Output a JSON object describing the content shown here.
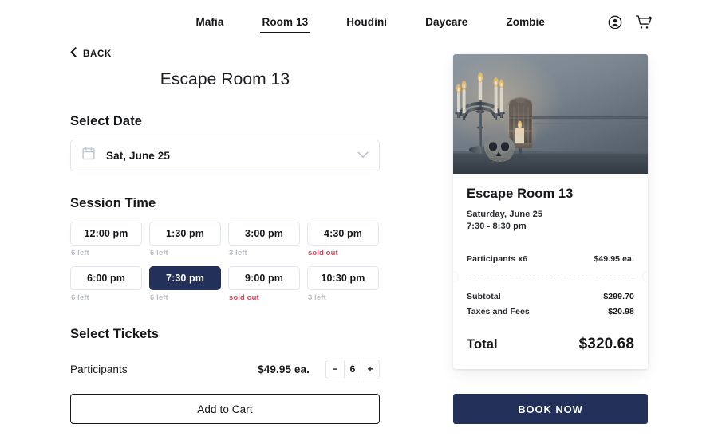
{
  "nav": {
    "links": [
      {
        "label": "Mafia",
        "active": false
      },
      {
        "label": "Room 13",
        "active": true
      },
      {
        "label": "Houdini",
        "active": false
      },
      {
        "label": "Daycare",
        "active": false
      },
      {
        "label": "Zombie",
        "active": false
      }
    ],
    "account_icon": "account-circle-icon",
    "cart_icon": "shopping-cart-icon"
  },
  "back": {
    "label": "BACK",
    "icon": "chevron-left-icon"
  },
  "page": {
    "title": "Escape Room 13"
  },
  "date": {
    "heading": "Select Date",
    "icon": "calendar-icon",
    "value": "Sat, June 25",
    "chevron": "chevron-down-icon"
  },
  "session": {
    "heading": "Session Time",
    "slots": [
      {
        "time": "12:00 pm",
        "note": "6 left",
        "sold_out": false,
        "selected": false
      },
      {
        "time": "1:30 pm",
        "note": "6 left",
        "sold_out": false,
        "selected": false
      },
      {
        "time": "3:00 pm",
        "note": "3 left",
        "sold_out": false,
        "selected": false
      },
      {
        "time": "4:30 pm",
        "note": "sold out",
        "sold_out": true,
        "selected": false
      },
      {
        "time": "6:00 pm",
        "note": "6 left",
        "sold_out": false,
        "selected": false
      },
      {
        "time": "7:30 pm",
        "note": "6 left",
        "sold_out": false,
        "selected": true
      },
      {
        "time": "9:00 pm",
        "note": "sold out",
        "sold_out": true,
        "selected": false
      },
      {
        "time": "10:30 pm",
        "note": "3 left",
        "sold_out": false,
        "selected": false
      }
    ]
  },
  "tickets": {
    "heading": "Select Tickets",
    "row": {
      "name": "Participants",
      "price": "$49.95 ea.",
      "quantity": "6",
      "minus": "−",
      "plus": "+"
    }
  },
  "actions": {
    "add_to_cart": "Add to Cart",
    "book_now": "BOOK NOW"
  },
  "summary": {
    "image_alt": "candelabra-skull-photo",
    "title": "Escape Room 13",
    "date": "Saturday, June 25",
    "time_range": "7:30 - 8:30 pm",
    "line_item": {
      "name": "Participants x6",
      "price": "$49.95 ea."
    },
    "rows": [
      {
        "label": "Subtotal",
        "value": "$299.70"
      },
      {
        "label": "Taxes and Fees",
        "value": "$20.98"
      }
    ],
    "total": {
      "label": "Total",
      "value": "$320.68"
    }
  },
  "colors": {
    "navy": "#22305a",
    "sold_out_red": "#e8425c",
    "muted_grey": "#b9bec7",
    "border": "#e3e6ec"
  }
}
